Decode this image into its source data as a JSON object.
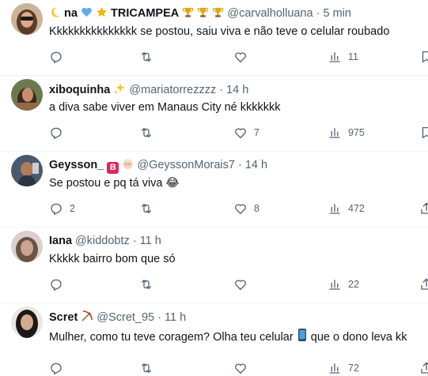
{
  "tweets": [
    {
      "display_name": "na",
      "name_suffix": "TRICAMPEA",
      "handle": "@carvalholluana",
      "time": "5 min",
      "text": "Kkkkkkkkkkkkkkk se postou, saiu viva e não teve o celular roubado",
      "replies": "",
      "retweets": "",
      "likes": "",
      "views": "11"
    },
    {
      "display_name": "xiboquinha",
      "handle": "@mariatorrezzzz",
      "time": "14 h",
      "text": "a diva sabe viver em Manaus City né kkkkkkk",
      "replies": "",
      "retweets": "",
      "likes": "7",
      "views": "975"
    },
    {
      "display_name": "Geysson_",
      "badge": "B",
      "handle": "@GeyssonMorais7",
      "time": "14 h",
      "text": "Se postou e pq tá viva 😂",
      "replies": "2",
      "retweets": "",
      "likes": "8",
      "views": "472"
    },
    {
      "display_name": "Iana",
      "handle": "@kiddobtz",
      "time": "11 h",
      "text": "Kkkkk bairro bom que só",
      "replies": "",
      "retweets": "",
      "likes": "",
      "views": "22"
    },
    {
      "display_name": "Scret",
      "handle": "@Scret_95",
      "time": "11 h",
      "text_before": "Mulher, como tu teve coragem? Olha teu celular",
      "text_after": "que o dono leva kk",
      "replies": "",
      "retweets": "",
      "likes": "",
      "views": "72"
    }
  ],
  "separator": "·",
  "colors": {
    "text": "#0f1419",
    "secondary": "#536471",
    "divider": "#eff3f4"
  }
}
